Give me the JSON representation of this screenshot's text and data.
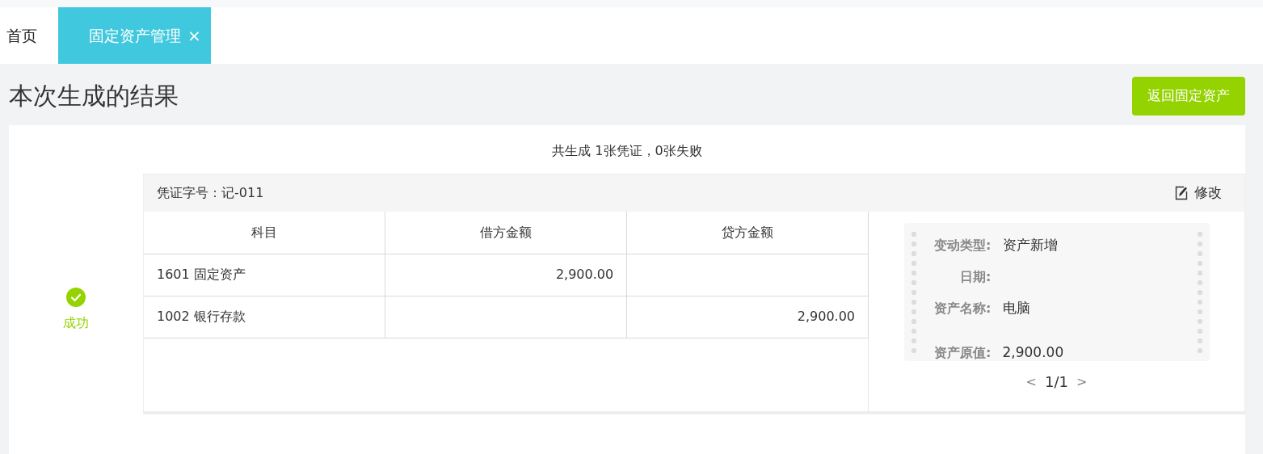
{
  "tabs": [
    {
      "label": "首页",
      "selected": false
    },
    {
      "label": "固定资产管理",
      "selected": true,
      "close": "×"
    }
  ],
  "page_title": "本次生成的结果",
  "back_button": "返回固定资产",
  "summary": "共生成 1张凭证，0张失败",
  "result": {
    "success": true,
    "label": "成功"
  },
  "voucher": {
    "number": "凭证字号：记-011",
    "edit": "修改",
    "table": {
      "columns": [
        "科目",
        "借方金额",
        "贷方金额"
      ],
      "rows": [
        {
          "account": "1601 固定资产",
          "debit": "2,900.00",
          "credit": ""
        },
        {
          "account": "1002 银行存款",
          "debit": "",
          "credit": "2,900.00"
        }
      ]
    },
    "details": [
      {
        "label": "变动类型:",
        "value": "资产新增"
      },
      {
        "label": "日期:"
      },
      {
        "label": "资产名称:",
        "value": "电脑"
      },
      {
        "label": "资产原值:",
        "value": "2,900.00"
      }
    ],
    "pager": {
      "prev": "<",
      "page": "1/1",
      "next": ">"
    }
  }
}
